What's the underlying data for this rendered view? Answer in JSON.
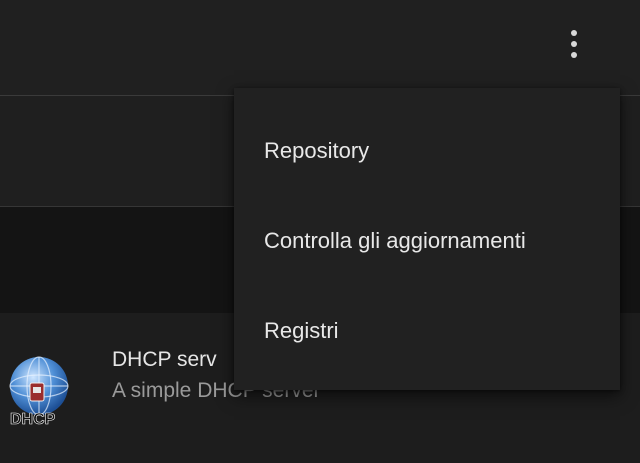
{
  "toolbar": {
    "overflow_icon": "more-vert-icon"
  },
  "list": {
    "items": [
      {
        "icon": "dhcp-globe-icon",
        "icon_label": "DHCP",
        "title": "DHCP serv",
        "subtitle": "A simple DHCP server"
      }
    ]
  },
  "menu": {
    "items": [
      {
        "label": "Repository"
      },
      {
        "label": "Controlla gli aggiornamenti"
      },
      {
        "label": "Registri"
      }
    ]
  },
  "colors": {
    "background": "#1d1d1d",
    "toolbar": "#202020",
    "menu_background": "#212121",
    "text_primary": "#e8e8e8",
    "text_secondary": "#9a9a9a"
  }
}
